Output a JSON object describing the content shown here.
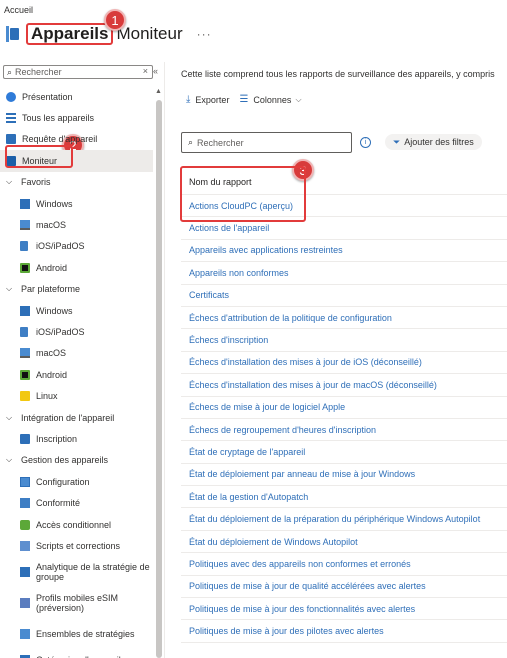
{
  "breadcrumb": "Accueil",
  "header": {
    "title": "Appareils",
    "subtitle": "Moniteur",
    "more": "···"
  },
  "badges": [
    "1",
    "2",
    "3"
  ],
  "sidebar": {
    "search_placeholder": "Rechercher",
    "clear": "×",
    "collapse": "«",
    "items": [
      {
        "label": "Présentation",
        "icon": "info-icon",
        "type": "top"
      },
      {
        "label": "Tous les appareils",
        "icon": "list-icon",
        "type": "top"
      },
      {
        "label": "Requête d'appareil",
        "icon": "document-icon",
        "type": "top"
      },
      {
        "label": "Moniteur",
        "icon": "monitor-icon",
        "type": "top",
        "active": true
      },
      {
        "label": "Favoris",
        "type": "group"
      },
      {
        "label": "Windows",
        "icon": "windows-icon",
        "type": "sub"
      },
      {
        "label": "macOS",
        "icon": "macos-icon",
        "type": "sub"
      },
      {
        "label": "iOS/iPadOS",
        "icon": "ios-icon",
        "type": "sub"
      },
      {
        "label": "Android",
        "icon": "android-icon",
        "type": "sub"
      },
      {
        "label": "Par plateforme",
        "type": "group"
      },
      {
        "label": "Windows",
        "icon": "windows-icon",
        "type": "sub"
      },
      {
        "label": "iOS/iPadOS",
        "icon": "ios-icon",
        "type": "sub"
      },
      {
        "label": "macOS",
        "icon": "macos-icon",
        "type": "sub"
      },
      {
        "label": "Android",
        "icon": "android-icon",
        "type": "sub"
      },
      {
        "label": "Linux",
        "icon": "linux-icon",
        "type": "sub"
      },
      {
        "label": "Intégration de l'appareil",
        "type": "group"
      },
      {
        "label": "Inscription",
        "icon": "enrollment-icon",
        "type": "sub"
      },
      {
        "label": "Gestion des appareils",
        "type": "group"
      },
      {
        "label": "Configuration",
        "icon": "configuration-icon",
        "type": "sub"
      },
      {
        "label": "Conformité",
        "icon": "compliance-icon",
        "type": "sub"
      },
      {
        "label": "Accès conditionnel",
        "icon": "conditional-access-icon",
        "type": "sub"
      },
      {
        "label": "Scripts et corrections",
        "icon": "scripts-icon",
        "type": "sub"
      },
      {
        "label": "Analytique de la stratégie de groupe",
        "icon": "analytics-icon",
        "type": "sub2"
      },
      {
        "label": "Profils mobiles eSIM (préversion)",
        "icon": "esim-icon",
        "type": "sub2"
      },
      {
        "label": "Ensembles de stratégies",
        "icon": "policy-sets-icon",
        "type": "sub2"
      },
      {
        "label": "Catégories d'appareil",
        "icon": "category-icon",
        "type": "sub"
      }
    ]
  },
  "main": {
    "description": "Cette liste comprend tous les rapports de surveillance des appareils, y compris",
    "toolbar": {
      "export": "Exporter",
      "columns": "Colonnes"
    },
    "search_placeholder": "Rechercher",
    "filter_button": "Ajouter des filtres",
    "table_header": "Nom du rapport",
    "reports": [
      "Actions CloudPC (aperçu)",
      "Actions de l'appareil",
      "Appareils avec applications restreintes",
      "Appareils non conformes",
      "Certificats",
      "Échecs d'attribution de la politique de configuration",
      "Échecs d'inscription",
      "Échecs d'installation des mises à jour de iOS (déconseillé)",
      "Échecs d'installation des mises à jour de macOS (déconseillé)",
      "Échecs de mise à jour de logiciel Apple",
      "Échecs de regroupement d'heures d'inscription",
      "État de cryptage de l'appareil",
      "État de déploiement par anneau de mise à jour Windows",
      "État de la gestion d'Autopatch",
      "État du déploiement de la préparation du périphérique Windows Autopilot",
      "État du déploiement de Windows Autopilot",
      "Politiques avec des appareils non conformes et erronés",
      "Politiques de mise à jour de qualité accélérées avec alertes",
      "Politiques de mise à jour des fonctionnalités avec alertes",
      "Politiques de mise à jour des pilotes avec alertes"
    ]
  },
  "colors": {
    "accent": "#2f6fb8",
    "highlight": "#e23b3b"
  }
}
